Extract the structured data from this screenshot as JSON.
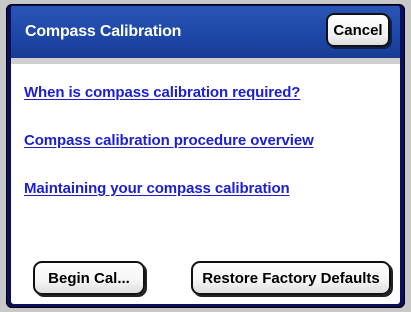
{
  "dialog": {
    "title": "Compass Calibration",
    "cancel_label": "Cancel"
  },
  "links": [
    {
      "label": "When is compass calibration required?"
    },
    {
      "label": "Compass calibration procedure overview"
    },
    {
      "label": "Maintaining your compass calibration"
    }
  ],
  "footer": {
    "begin_label": "Begin Cal...",
    "restore_label": "Restore Factory Defaults"
  },
  "colors": {
    "titlebar": "#1d46a6",
    "frame": "#0b0f5a",
    "link": "#1b1fcf"
  }
}
